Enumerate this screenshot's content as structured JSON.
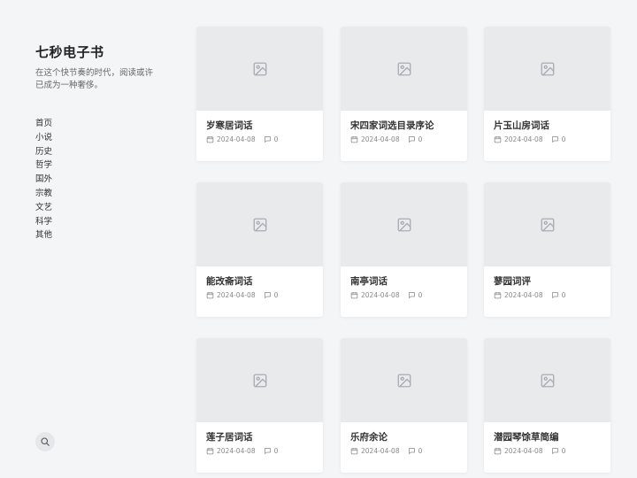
{
  "site": {
    "title": "七秒电子书",
    "description": "在这个快节奏的时代，阅读或许已成为一种奢侈。"
  },
  "nav": [
    "首页",
    "小说",
    "历史",
    "哲学",
    "国外",
    "宗教",
    "文艺",
    "科学",
    "其他"
  ],
  "search": {
    "icon": "search-icon"
  },
  "posts": [
    {
      "title": "岁寒居词话",
      "date": "2024-04-08",
      "comments": "0"
    },
    {
      "title": "宋四家词选目录序论",
      "date": "2024-04-08",
      "comments": "0"
    },
    {
      "title": "片玉山房词话",
      "date": "2024-04-08",
      "comments": "0"
    },
    {
      "title": "能改斋词话",
      "date": "2024-04-08",
      "comments": "0"
    },
    {
      "title": "南亭词话",
      "date": "2024-04-08",
      "comments": "0"
    },
    {
      "title": "蓼园词评",
      "date": "2024-04-08",
      "comments": "0"
    },
    {
      "title": "莲子居词话",
      "date": "2024-04-08",
      "comments": "0"
    },
    {
      "title": "乐府余论",
      "date": "2024-04-08",
      "comments": "0"
    },
    {
      "title": "潜园琴馀草简编",
      "date": "2024-04-08",
      "comments": "0"
    }
  ]
}
